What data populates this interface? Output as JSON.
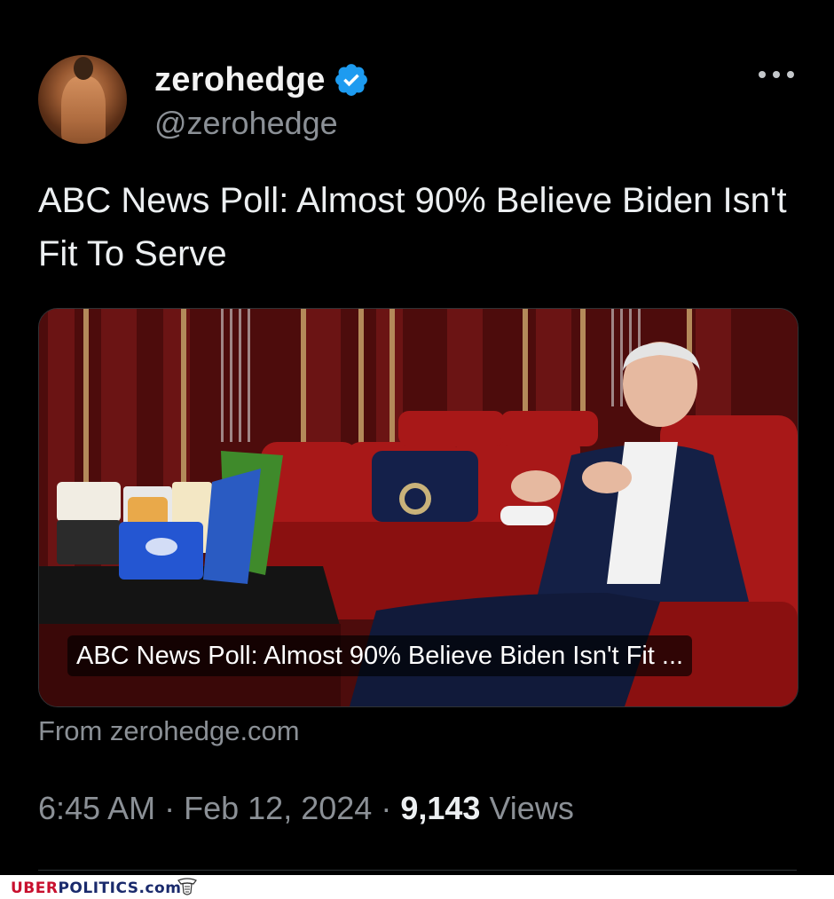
{
  "author": {
    "display_name": "zerohedge",
    "handle": "@zerohedge",
    "verified": true,
    "verified_color": "#1d9bf0"
  },
  "tweet": {
    "text": "ABC News Poll: Almost 90% Believe Biden Isn't Fit To Serve"
  },
  "link_card": {
    "title": "ABC News Poll: Almost 90% Believe Biden Isn't Fit ...",
    "source": "From zerohedge.com"
  },
  "meta": {
    "time": "6:45 AM",
    "date": "Feb 12, 2024",
    "separator": "·",
    "views_count": "9,143",
    "views_label": "Views"
  },
  "icons": {
    "more": "more-horizontal-icon",
    "verified": "verified-badge-icon"
  },
  "watermark": {
    "part1": "UBER",
    "part2": "POLITICS.com"
  }
}
